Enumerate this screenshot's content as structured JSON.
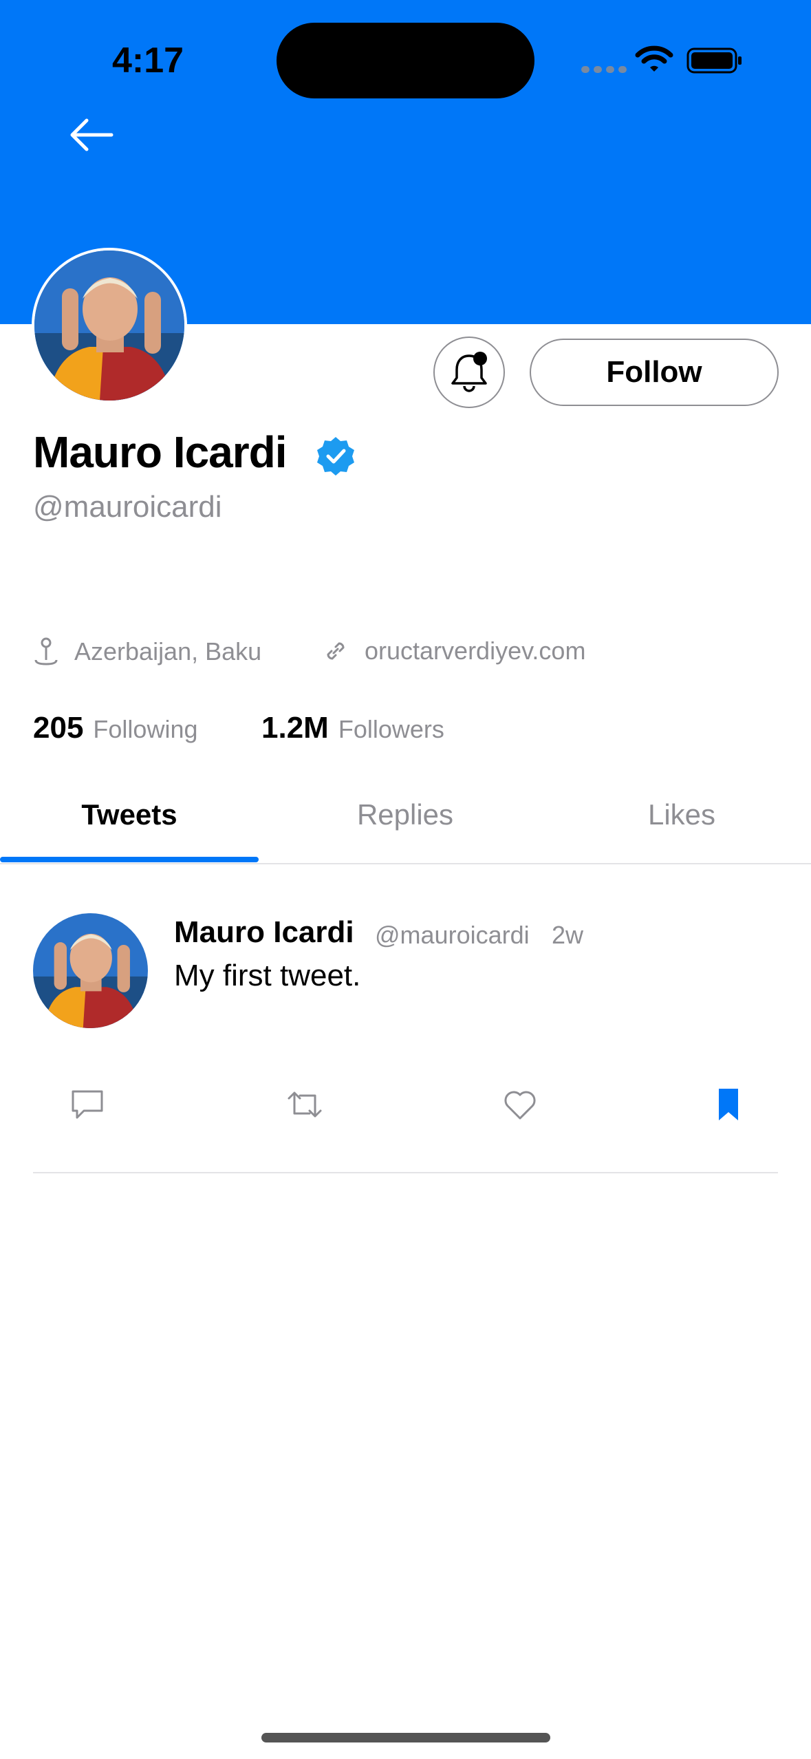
{
  "status_bar": {
    "time": "4:17"
  },
  "profile": {
    "name": "Mauro Icardi",
    "handle": "@mauroicardi",
    "location": "Azerbaijan, Baku",
    "website": "oructarverdiyev.com",
    "following_count": "205",
    "following_label": "Following",
    "followers_count": "1.2M",
    "followers_label": "Followers",
    "follow_button_label": "Follow"
  },
  "tabs": [
    {
      "label": "Tweets",
      "active": true
    },
    {
      "label": "Replies",
      "active": false
    },
    {
      "label": "Likes",
      "active": false
    }
  ],
  "tweet": {
    "author": "Mauro Icardi",
    "handle": "@mauroicardi",
    "time": "2w",
    "text": "My first tweet.",
    "bookmarked": true
  },
  "icons": [
    "back-arrow-icon",
    "notification-bell-icon",
    "verified-badge-icon",
    "location-pin-icon",
    "link-icon",
    "reply-icon",
    "retweet-icon",
    "like-icon",
    "bookmark-icon"
  ],
  "colors": {
    "accent": "#0077f8",
    "secondary_text": "#8e8e93"
  }
}
